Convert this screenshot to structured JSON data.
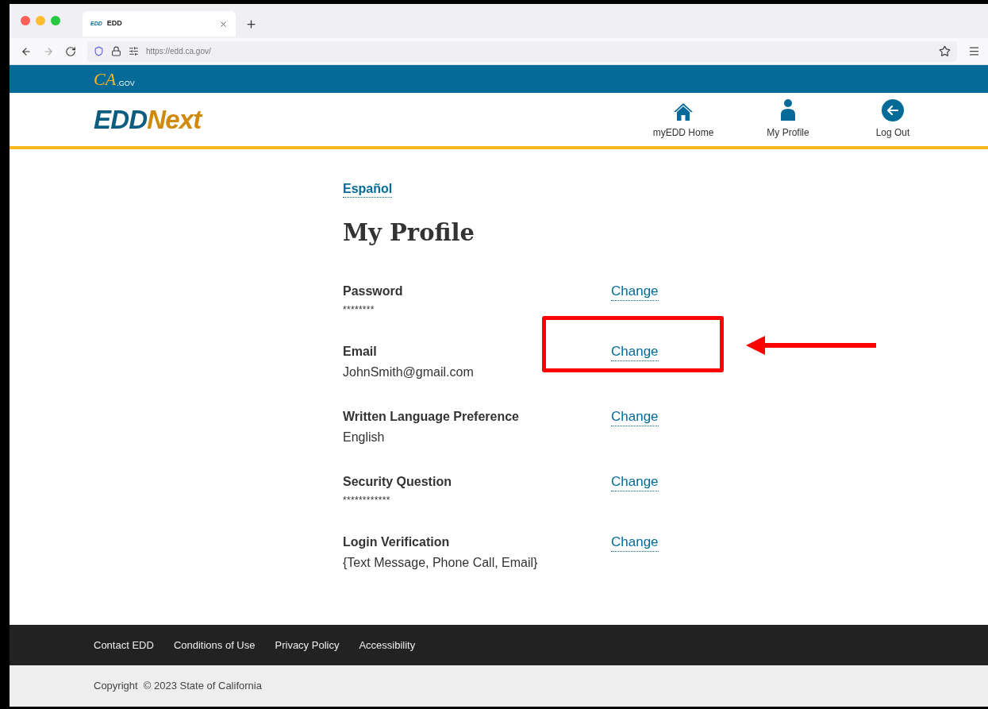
{
  "browser": {
    "tab": {
      "favicon_text": "EDD",
      "title": "EDD"
    },
    "url": "https://edd.ca.gov/"
  },
  "site_banner": {
    "logo_script": "CA",
    "logo_suffix": ".GOV"
  },
  "header": {
    "logo_left": "EDD",
    "logo_right": "Next",
    "nav": [
      {
        "kind": "home",
        "label": "myEDD Home"
      },
      {
        "kind": "profile",
        "label": "My Profile"
      },
      {
        "kind": "logout",
        "label": "Log Out"
      }
    ]
  },
  "language_link": "Español",
  "title": "My Profile",
  "rows": [
    {
      "label": "Password",
      "value": "********",
      "masked": true,
      "action": "Change",
      "highlighted": false
    },
    {
      "label": "Email",
      "value": "JohnSmith@gmail.com",
      "masked": false,
      "action": "Change",
      "highlighted": true
    },
    {
      "label": "Written Language Preference",
      "value": "English",
      "masked": false,
      "action": "Change",
      "highlighted": false
    },
    {
      "label": "Security Question",
      "value": "************",
      "masked": true,
      "action": "Change",
      "highlighted": false
    },
    {
      "label": "Login Verification",
      "value": "{Text Message, Phone Call, Email}",
      "masked": false,
      "action": "Change",
      "highlighted": false
    }
  ],
  "footer": {
    "links": [
      "Contact EDD",
      "Conditions of Use",
      "Privacy Policy",
      "Accessibility"
    ],
    "copyright": "Copyright  © 2023 State of California"
  }
}
